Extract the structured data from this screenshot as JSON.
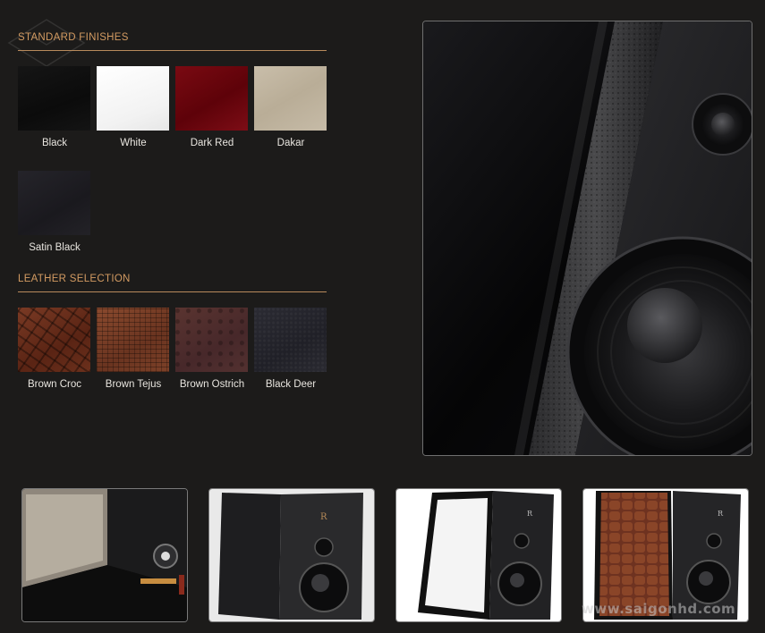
{
  "standard_finishes": {
    "title": "STANDARD FINISHES",
    "items": [
      {
        "label": "Black",
        "color": "#0f0f0f"
      },
      {
        "label": "White",
        "color": "#ffffff"
      },
      {
        "label": "Dark Red",
        "color": "#6a0610"
      },
      {
        "label": "Dakar",
        "color": "#c2b6a1"
      },
      {
        "label": "Satin Black",
        "color": "#1f1e23"
      }
    ]
  },
  "leather_selection": {
    "title": "LEATHER SELECTION",
    "items": [
      {
        "label": "Brown Croc",
        "color": "#6a2e1a"
      },
      {
        "label": "Brown Tejus",
        "color": "#7a3e24"
      },
      {
        "label": "Brown Ostrich",
        "color": "#4f2e2c"
      },
      {
        "label": "Black Deer",
        "color": "#25252c"
      }
    ]
  },
  "gallery": {
    "thumbnails": [
      {
        "name": "rear-panel"
      },
      {
        "name": "black-speaker"
      },
      {
        "name": "white-speaker"
      },
      {
        "name": "croc-speaker"
      }
    ]
  },
  "watermark": "www.saigonhd.com",
  "colors": {
    "accent": "#d39b62",
    "background": "#1c1b1a",
    "divider": "#b88a5c"
  }
}
